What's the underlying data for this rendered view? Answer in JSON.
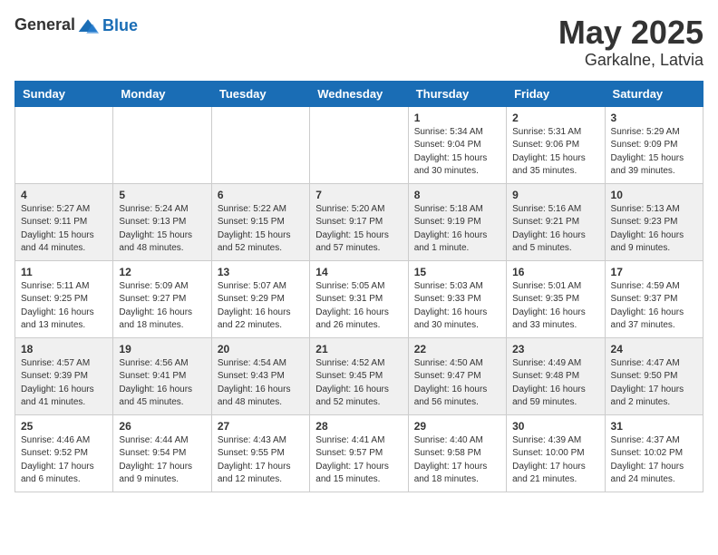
{
  "header": {
    "logo_general": "General",
    "logo_blue": "Blue",
    "title": "May 2025",
    "location": "Garkalne, Latvia"
  },
  "weekdays": [
    "Sunday",
    "Monday",
    "Tuesday",
    "Wednesday",
    "Thursday",
    "Friday",
    "Saturday"
  ],
  "weeks": [
    [
      {
        "day": "",
        "info": ""
      },
      {
        "day": "",
        "info": ""
      },
      {
        "day": "",
        "info": ""
      },
      {
        "day": "",
        "info": ""
      },
      {
        "day": "1",
        "info": "Sunrise: 5:34 AM\nSunset: 9:04 PM\nDaylight: 15 hours\nand 30 minutes."
      },
      {
        "day": "2",
        "info": "Sunrise: 5:31 AM\nSunset: 9:06 PM\nDaylight: 15 hours\nand 35 minutes."
      },
      {
        "day": "3",
        "info": "Sunrise: 5:29 AM\nSunset: 9:09 PM\nDaylight: 15 hours\nand 39 minutes."
      }
    ],
    [
      {
        "day": "4",
        "info": "Sunrise: 5:27 AM\nSunset: 9:11 PM\nDaylight: 15 hours\nand 44 minutes."
      },
      {
        "day": "5",
        "info": "Sunrise: 5:24 AM\nSunset: 9:13 PM\nDaylight: 15 hours\nand 48 minutes."
      },
      {
        "day": "6",
        "info": "Sunrise: 5:22 AM\nSunset: 9:15 PM\nDaylight: 15 hours\nand 52 minutes."
      },
      {
        "day": "7",
        "info": "Sunrise: 5:20 AM\nSunset: 9:17 PM\nDaylight: 15 hours\nand 57 minutes."
      },
      {
        "day": "8",
        "info": "Sunrise: 5:18 AM\nSunset: 9:19 PM\nDaylight: 16 hours\nand 1 minute."
      },
      {
        "day": "9",
        "info": "Sunrise: 5:16 AM\nSunset: 9:21 PM\nDaylight: 16 hours\nand 5 minutes."
      },
      {
        "day": "10",
        "info": "Sunrise: 5:13 AM\nSunset: 9:23 PM\nDaylight: 16 hours\nand 9 minutes."
      }
    ],
    [
      {
        "day": "11",
        "info": "Sunrise: 5:11 AM\nSunset: 9:25 PM\nDaylight: 16 hours\nand 13 minutes."
      },
      {
        "day": "12",
        "info": "Sunrise: 5:09 AM\nSunset: 9:27 PM\nDaylight: 16 hours\nand 18 minutes."
      },
      {
        "day": "13",
        "info": "Sunrise: 5:07 AM\nSunset: 9:29 PM\nDaylight: 16 hours\nand 22 minutes."
      },
      {
        "day": "14",
        "info": "Sunrise: 5:05 AM\nSunset: 9:31 PM\nDaylight: 16 hours\nand 26 minutes."
      },
      {
        "day": "15",
        "info": "Sunrise: 5:03 AM\nSunset: 9:33 PM\nDaylight: 16 hours\nand 30 minutes."
      },
      {
        "day": "16",
        "info": "Sunrise: 5:01 AM\nSunset: 9:35 PM\nDaylight: 16 hours\nand 33 minutes."
      },
      {
        "day": "17",
        "info": "Sunrise: 4:59 AM\nSunset: 9:37 PM\nDaylight: 16 hours\nand 37 minutes."
      }
    ],
    [
      {
        "day": "18",
        "info": "Sunrise: 4:57 AM\nSunset: 9:39 PM\nDaylight: 16 hours\nand 41 minutes."
      },
      {
        "day": "19",
        "info": "Sunrise: 4:56 AM\nSunset: 9:41 PM\nDaylight: 16 hours\nand 45 minutes."
      },
      {
        "day": "20",
        "info": "Sunrise: 4:54 AM\nSunset: 9:43 PM\nDaylight: 16 hours\nand 48 minutes."
      },
      {
        "day": "21",
        "info": "Sunrise: 4:52 AM\nSunset: 9:45 PM\nDaylight: 16 hours\nand 52 minutes."
      },
      {
        "day": "22",
        "info": "Sunrise: 4:50 AM\nSunset: 9:47 PM\nDaylight: 16 hours\nand 56 minutes."
      },
      {
        "day": "23",
        "info": "Sunrise: 4:49 AM\nSunset: 9:48 PM\nDaylight: 16 hours\nand 59 minutes."
      },
      {
        "day": "24",
        "info": "Sunrise: 4:47 AM\nSunset: 9:50 PM\nDaylight: 17 hours\nand 2 minutes."
      }
    ],
    [
      {
        "day": "25",
        "info": "Sunrise: 4:46 AM\nSunset: 9:52 PM\nDaylight: 17 hours\nand 6 minutes."
      },
      {
        "day": "26",
        "info": "Sunrise: 4:44 AM\nSunset: 9:54 PM\nDaylight: 17 hours\nand 9 minutes."
      },
      {
        "day": "27",
        "info": "Sunrise: 4:43 AM\nSunset: 9:55 PM\nDaylight: 17 hours\nand 12 minutes."
      },
      {
        "day": "28",
        "info": "Sunrise: 4:41 AM\nSunset: 9:57 PM\nDaylight: 17 hours\nand 15 minutes."
      },
      {
        "day": "29",
        "info": "Sunrise: 4:40 AM\nSunset: 9:58 PM\nDaylight: 17 hours\nand 18 minutes."
      },
      {
        "day": "30",
        "info": "Sunrise: 4:39 AM\nSunset: 10:00 PM\nDaylight: 17 hours\nand 21 minutes."
      },
      {
        "day": "31",
        "info": "Sunrise: 4:37 AM\nSunset: 10:02 PM\nDaylight: 17 hours\nand 24 minutes."
      }
    ]
  ]
}
